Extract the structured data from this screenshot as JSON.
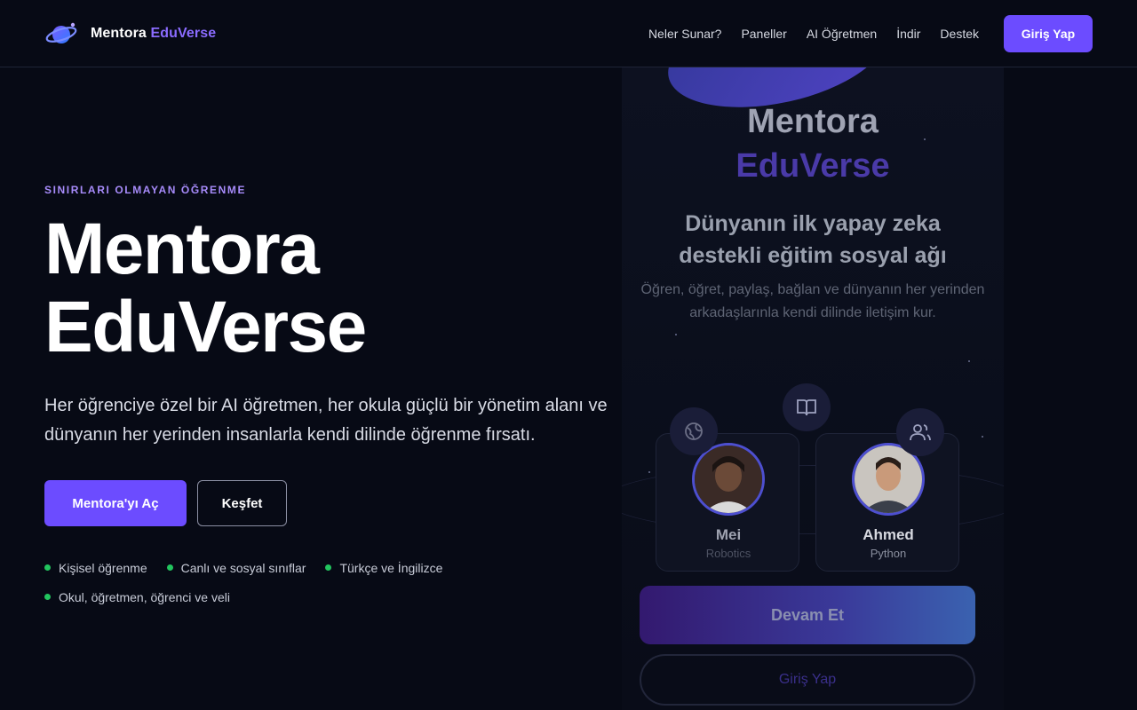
{
  "nav": {
    "brand_main": "Mentora",
    "brand_accent": "EduVerse",
    "links": [
      "Neler Sunar?",
      "Paneller",
      "AI Öğretmen",
      "İndir",
      "Destek"
    ],
    "cta": "Giriş Yap"
  },
  "hero": {
    "eyebrow": "SINIRLARI OLMAYAN ÖĞRENME",
    "title_line1": "Mentora",
    "title_line2": "EduVerse",
    "lead": "Her öğrenciye özel bir AI öğretmen, her okula güçlü bir yönetim alanı ve dünyanın her yerinden insanlarla kendi dilinde öğrenme fırsatı.",
    "primary_button": "Mentora'yı Aç",
    "secondary_button": "Keşfet",
    "features": [
      "Kişisel öğrenme",
      "Canlı ve sosyal sınıflar",
      "Türkçe ve İngilizce",
      "Okul, öğretmen, öğrenci ve veli"
    ]
  },
  "phone": {
    "title_line1": "Mentora",
    "title_line2": "EduVerse",
    "subtitle": "Dünyanın ilk yapay zeka destekli eğitim sosyal ağı",
    "description": "Öğren, öğret, paylaş, bağlan ve dünyanın her yerinden arkadaşlarınla kendi dilinde iletişim kur.",
    "cards": [
      {
        "name": "Mei",
        "role": "Robotics"
      },
      {
        "name": "Ahmed",
        "role": "Python"
      }
    ],
    "continue_button": "Devam Et",
    "login_button": "Giriş Yap"
  },
  "colors": {
    "background": "#070a15",
    "accent": "#6c4cff",
    "accent_text": "#8b6cff",
    "eyebrow": "#a78bfa",
    "feature_dot": "#22c55e"
  },
  "icons": {
    "logo": "planet-logo-icon",
    "phone_icons": [
      "globe-icon",
      "book-icon",
      "users-icon"
    ]
  }
}
